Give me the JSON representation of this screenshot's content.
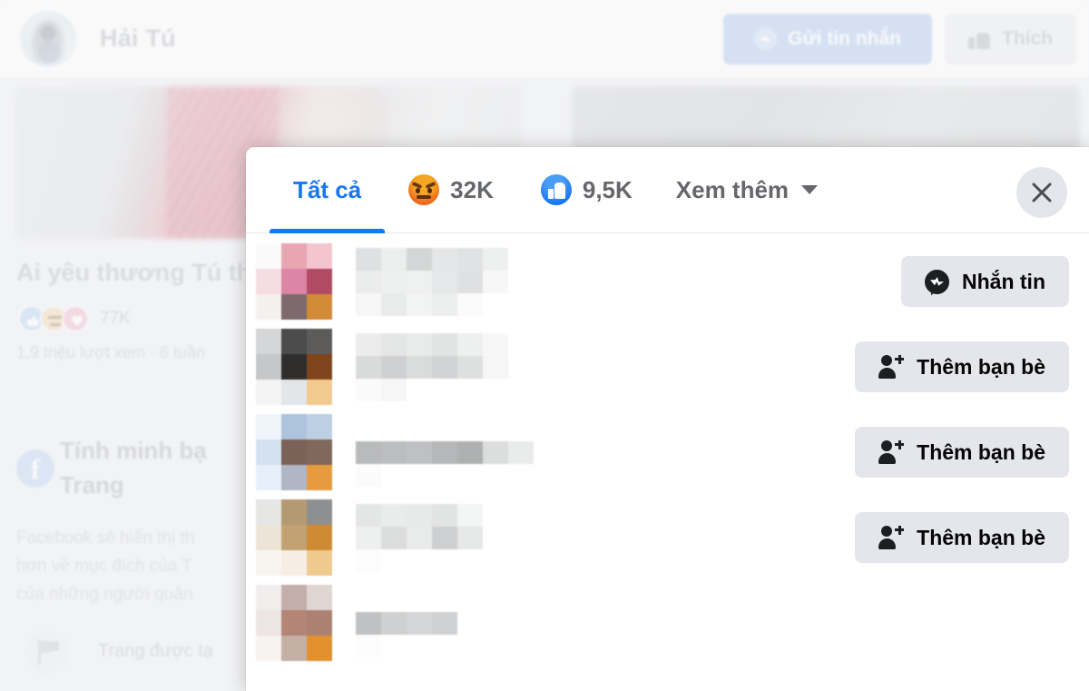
{
  "profile": {
    "name": "Hải Tú",
    "avatar_icon": "profile-avatar",
    "message_button": {
      "label": "Gửi tin nhắn",
      "icon": "messenger-icon",
      "bg_color": "#bed4f2",
      "text_color": "#ffffff"
    },
    "like_button": {
      "label": "Thích",
      "icon": "thumbs-up-icon",
      "bg_color": "#f0f1f3"
    }
  },
  "background_post": {
    "title": "Ai yêu thương Tú th",
    "reactions": {
      "icons": [
        "like-reaction-icon",
        "angry-reaction-icon",
        "love-reaction-icon"
      ],
      "count": "77K"
    },
    "meta": "1,9 triệu lượt xem · 6 tuần"
  },
  "transparency_card": {
    "icon": "facebook-icon",
    "icon_glyph": "f",
    "title": "Tính minh bạ\nTrang",
    "body": "Facebook sẽ hiển thị th\nhơn về mục đích của T\ncủa những người quản",
    "page_created": {
      "icon": "flag-icon",
      "label": "Trang được tạ"
    }
  },
  "modal": {
    "close_button": {
      "icon": "close-icon",
      "label": "Đóng"
    },
    "accent_color": "#1877f2",
    "tabs": [
      {
        "id": "all",
        "label": "Tất cả",
        "icon": null,
        "count": null,
        "active": true
      },
      {
        "id": "angry",
        "label": "",
        "icon": "angry-emoji-icon",
        "count": "32K",
        "active": false
      },
      {
        "id": "like",
        "label": "",
        "icon": "like-emoji-icon",
        "count": "9,5K",
        "active": false
      }
    ],
    "more_tab": {
      "label": "Xem thêm",
      "icon": "chevron-down-icon"
    },
    "people": [
      {
        "name_redacted": true,
        "action": {
          "label": "Nhắn tin",
          "icon": "messenger-icon"
        }
      },
      {
        "name_redacted": true,
        "action": {
          "label": "Thêm bạn bè",
          "icon": "add-friend-icon"
        }
      },
      {
        "name_redacted": true,
        "action": {
          "label": "Thêm bạn bè",
          "icon": "add-friend-icon"
        }
      },
      {
        "name_redacted": true,
        "action": {
          "label": "Thêm bạn bè",
          "icon": "add-friend-icon"
        }
      },
      {
        "name_redacted": true,
        "action": null
      }
    ]
  }
}
